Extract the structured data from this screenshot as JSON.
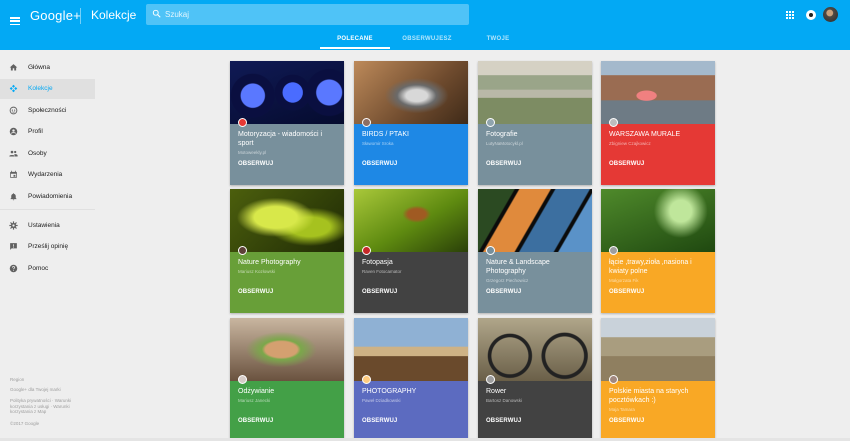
{
  "header": {
    "menu_icon": "menu-icon",
    "logo": "Google+",
    "section_title": "Kolekcje",
    "search": {
      "placeholder": "Szukaj",
      "value": ""
    },
    "icons": [
      "apps-icon",
      "notifications-icon",
      "avatar"
    ]
  },
  "tabs": [
    {
      "label": "POLECANE",
      "active": true
    },
    {
      "label": "OBSERWUJESZ",
      "active": false
    },
    {
      "label": "TWOJE",
      "active": false
    }
  ],
  "sidebar": {
    "items": [
      {
        "label": "Główna",
        "icon": "home-icon",
        "active": false
      },
      {
        "label": "Kolekcje",
        "icon": "collections-icon",
        "active": true
      },
      {
        "label": "Społeczności",
        "icon": "communities-icon",
        "active": false
      },
      {
        "label": "Profil",
        "icon": "profile-icon",
        "active": false
      },
      {
        "label": "Osoby",
        "icon": "people-icon",
        "active": false
      },
      {
        "label": "Wydarzenia",
        "icon": "events-icon",
        "active": false
      },
      {
        "label": "Powiadomienia",
        "icon": "bell-icon",
        "active": false
      }
    ],
    "secondary_items": [
      {
        "label": "Ustawienia",
        "icon": "gear-icon"
      },
      {
        "label": "Prześlij opinię",
        "icon": "feedback-icon"
      },
      {
        "label": "Pomoc",
        "icon": "help-icon"
      }
    ],
    "footer": {
      "region": "Region",
      "brand": "Google+ dla Twojej marki",
      "policy": "Polityka prywatności · Warunki korzystania z usługi · Warunki korzystania z Map",
      "copyright": "©2017 Google"
    }
  },
  "collections": [
    {
      "title": "Motoryzacja - wiadomości i sport",
      "owner": "Motoweekly.pl",
      "follow_label": "OBSERWUJ",
      "band_color": "#78909c"
    },
    {
      "title": "BIRDS / PTAKI",
      "owner": "Sławomir Sroka",
      "follow_label": "OBSERWUJ",
      "band_color": "#1e88e5"
    },
    {
      "title": "Fotografie",
      "owner": "LutyNaMotocykl.pl",
      "follow_label": "OBSERWUJ",
      "band_color": "#78909c"
    },
    {
      "title": "WARSZAWA MURALE",
      "owner": "Zbigniew Czajkowicz",
      "follow_label": "OBSERWUJ",
      "band_color": "#e53935"
    },
    {
      "title": "Nature Photography",
      "owner": "Mariusz Kozłowski",
      "follow_label": "OBSERWUJ",
      "band_color": "#689f38"
    },
    {
      "title": "Fotopasja",
      "owner": "Raven Fotocamator",
      "follow_label": "OBSERWUJ",
      "band_color": "#424242"
    },
    {
      "title": "Nature & Landscape Photography",
      "owner": "Grzegorz Piechowicz",
      "follow_label": "OBSERWUJ",
      "band_color": "#78909c"
    },
    {
      "title": "łącie ,trawy,zioła ,nasiona i kwiaty polne",
      "owner": "Małgorzata Fik",
      "follow_label": "OBSERWUJ",
      "band_color": "#f9a825"
    },
    {
      "title": "Odżywianie",
      "owner": "Mariusz Janecki",
      "follow_label": "OBSERWUJ",
      "band_color": "#43a047"
    },
    {
      "title": "PHOTOGRAPHY",
      "owner": "Paweł Dziadkowski",
      "follow_label": "OBSERWUJ",
      "band_color": "#5c6bc0"
    },
    {
      "title": "Rower",
      "owner": "Bartosz Danowski",
      "follow_label": "OBSERWUJ",
      "band_color": "#424242"
    },
    {
      "title": "Polskie miasta na starych pocztówkach :)",
      "owner": "Maja Tamara",
      "follow_label": "OBSERWUJ",
      "band_color": "#f9a825"
    }
  ]
}
